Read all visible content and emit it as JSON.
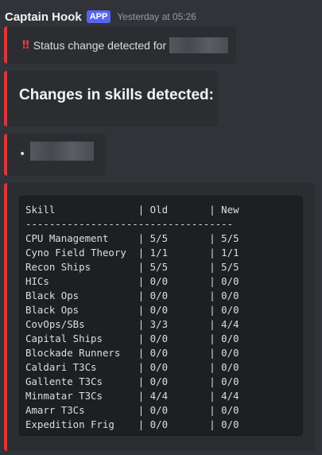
{
  "message": {
    "author": "Captain Hook",
    "badge": "APP",
    "timestamp": "Yesterday at 05:26"
  },
  "embed_status": {
    "icon": "!!",
    "text": "Status change detected for"
  },
  "embed_title": {
    "title": "Changes in skills detected:"
  },
  "embed_list": {
    "bullet": "•"
  },
  "embed_table": {
    "header": "Skill              | Old       | New",
    "separator": "-----------------------------------",
    "rows": [
      "CPU Management     | 5/5       | 5/5",
      "Cyno Field Theory  | 1/1       | 1/1",
      "Recon Ships        | 5/5       | 5/5",
      "HICs               | 0/0       | 0/0",
      "Black Ops          | 0/0       | 0/0",
      "Black Ops          | 0/0       | 0/0",
      "CovOps/SBs         | 3/3       | 4/4",
      "Capital Ships      | 0/0       | 0/0",
      "Blockade Runners   | 0/0       | 0/0",
      "Caldari T3Cs       | 0/0       | 0/0",
      "Gallente T3Cs      | 0/0       | 0/0",
      "Minmatar T3Cs      | 4/4       | 4/4",
      "Amarr T3Cs         | 0/0       | 0/0",
      "Expedition Frig    | 0/0       | 0/0"
    ]
  },
  "colors": {
    "background": "#313338",
    "embed_background": "#2b2d31",
    "embed_accent": "#da373c",
    "code_background": "#1e1f22",
    "badge": "#5865f2"
  }
}
